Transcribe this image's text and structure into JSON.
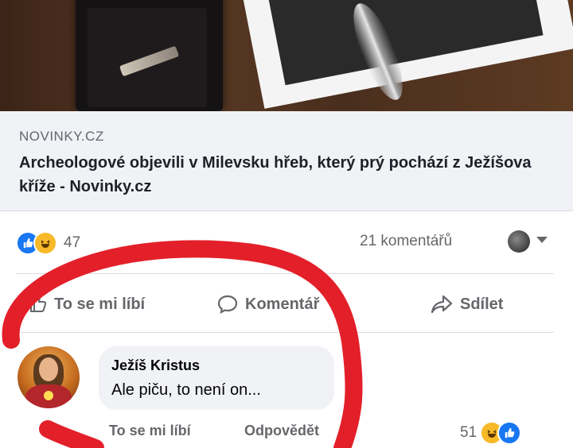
{
  "post": {
    "link_domain": "NOVINKY.CZ",
    "link_title": "Archeologové objevili v Milevsku hřeb, který prý pochází z Ježíšova kříže - Novinky.cz",
    "reaction_count": "47",
    "comment_count": "21 komentářů"
  },
  "actions": {
    "like": "To se mi líbí",
    "comment": "Komentář",
    "share": "Sdílet"
  },
  "comment": {
    "author": "Ježíš Kristus",
    "text": "Ale piču, to není on...",
    "like_link": "To se mi líbí",
    "reply_link": "Odpovědět",
    "reaction_count": "51"
  },
  "colors": {
    "facebook_blue": "#1877f2",
    "haha_yellow": "#f7b928",
    "annotation_red": "#e3202a"
  },
  "icons": [
    "like-icon",
    "haha-icon",
    "globe-icon",
    "comment-icon",
    "share-icon"
  ]
}
